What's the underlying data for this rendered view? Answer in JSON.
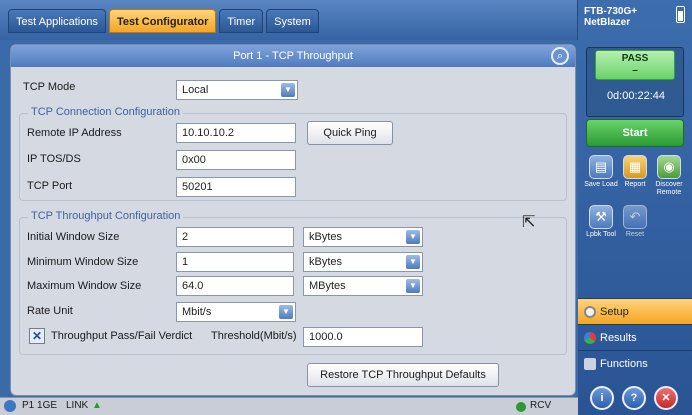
{
  "tabs": [
    "Test Applications",
    "Test Configurator",
    "Timer",
    "System"
  ],
  "active_tab": "Test Configurator",
  "panel": {
    "title": "Port 1 - TCP Throughput"
  },
  "tcp_mode": {
    "label": "TCP Mode",
    "value": "Local"
  },
  "connection": {
    "title": "TCP Connection Configuration",
    "remote_ip_label": "Remote IP Address",
    "remote_ip_value": "10.10.10.2",
    "quick_ping": "Quick Ping",
    "tos_label": "IP TOS/DS",
    "tos_value": "0x00",
    "port_label": "TCP Port",
    "port_value": "50201"
  },
  "throughput": {
    "title": "TCP Throughput Configuration",
    "initial_label": "Initial Window Size",
    "initial_value": "2",
    "initial_unit": "kBytes",
    "min_label": "Minimum Window Size",
    "min_value": "1",
    "min_unit": "kBytes",
    "max_label": "Maximum Window Size",
    "max_value": "64.0",
    "max_unit": "MBytes",
    "rate_label": "Rate Unit",
    "rate_value": "Mbit/s",
    "verdict_label": "Throughput Pass/Fail Verdict",
    "threshold_label": "Threshold(Mbit/s)",
    "threshold_value": "1000.0",
    "restore": "Restore TCP Throughput Defaults"
  },
  "status": {
    "port": "P1 1GE",
    "link": "LINK",
    "rcv": "RCV"
  },
  "side": {
    "device_line1": "FTB-730G+",
    "device_line2": "NetBlazer",
    "pass": "PASS",
    "pass_sub": "–",
    "timer": "0d:00:22:44",
    "start": "Start",
    "tools": [
      {
        "label": "Save Load",
        "icon": "save-icon"
      },
      {
        "label": "Report",
        "icon": "report-icon"
      },
      {
        "label": "Discover Remote",
        "icon": "discover-icon"
      },
      {
        "label": "Lpbk Tool",
        "icon": "loopback-icon"
      },
      {
        "label": "Reset",
        "icon": "reset-icon"
      }
    ],
    "nav": [
      "Setup",
      "Results",
      "Functions"
    ]
  }
}
